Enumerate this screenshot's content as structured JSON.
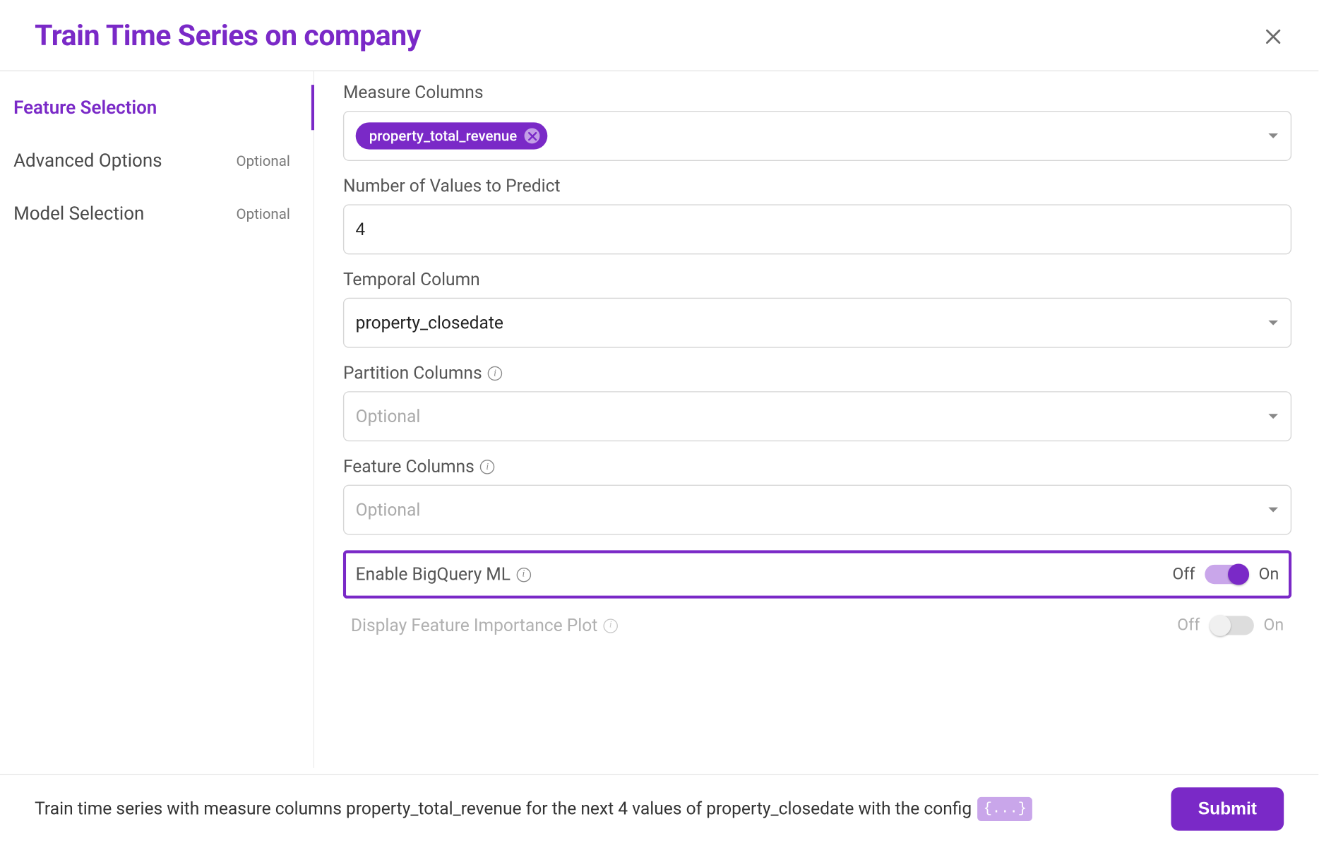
{
  "header": {
    "title": "Train Time Series on company"
  },
  "sidebar": {
    "items": [
      {
        "label": "Feature Selection",
        "sub": "",
        "active": true
      },
      {
        "label": "Advanced Options",
        "sub": "Optional",
        "active": false
      },
      {
        "label": "Model Selection",
        "sub": "Optional",
        "active": false
      }
    ]
  },
  "form": {
    "measure_columns": {
      "label": "Measure Columns",
      "chips": [
        {
          "text": "property_total_revenue"
        }
      ]
    },
    "num_values": {
      "label": "Number of Values to Predict",
      "value": "4"
    },
    "temporal_column": {
      "label": "Temporal Column",
      "value": "property_closedate"
    },
    "partition_columns": {
      "label": "Partition Columns",
      "placeholder": "Optional"
    },
    "feature_columns": {
      "label": "Feature Columns",
      "placeholder": "Optional"
    },
    "enable_bq": {
      "label": "Enable BigQuery ML",
      "off": "Off",
      "on": "On"
    },
    "display_fi": {
      "label": "Display Feature Importance Plot",
      "off": "Off",
      "on": "On"
    }
  },
  "footer": {
    "summary": "Train time series with measure columns property_total_revenue for the next 4 values of property_closedate with the config",
    "json_badge": "{...}",
    "submit": "Submit"
  }
}
